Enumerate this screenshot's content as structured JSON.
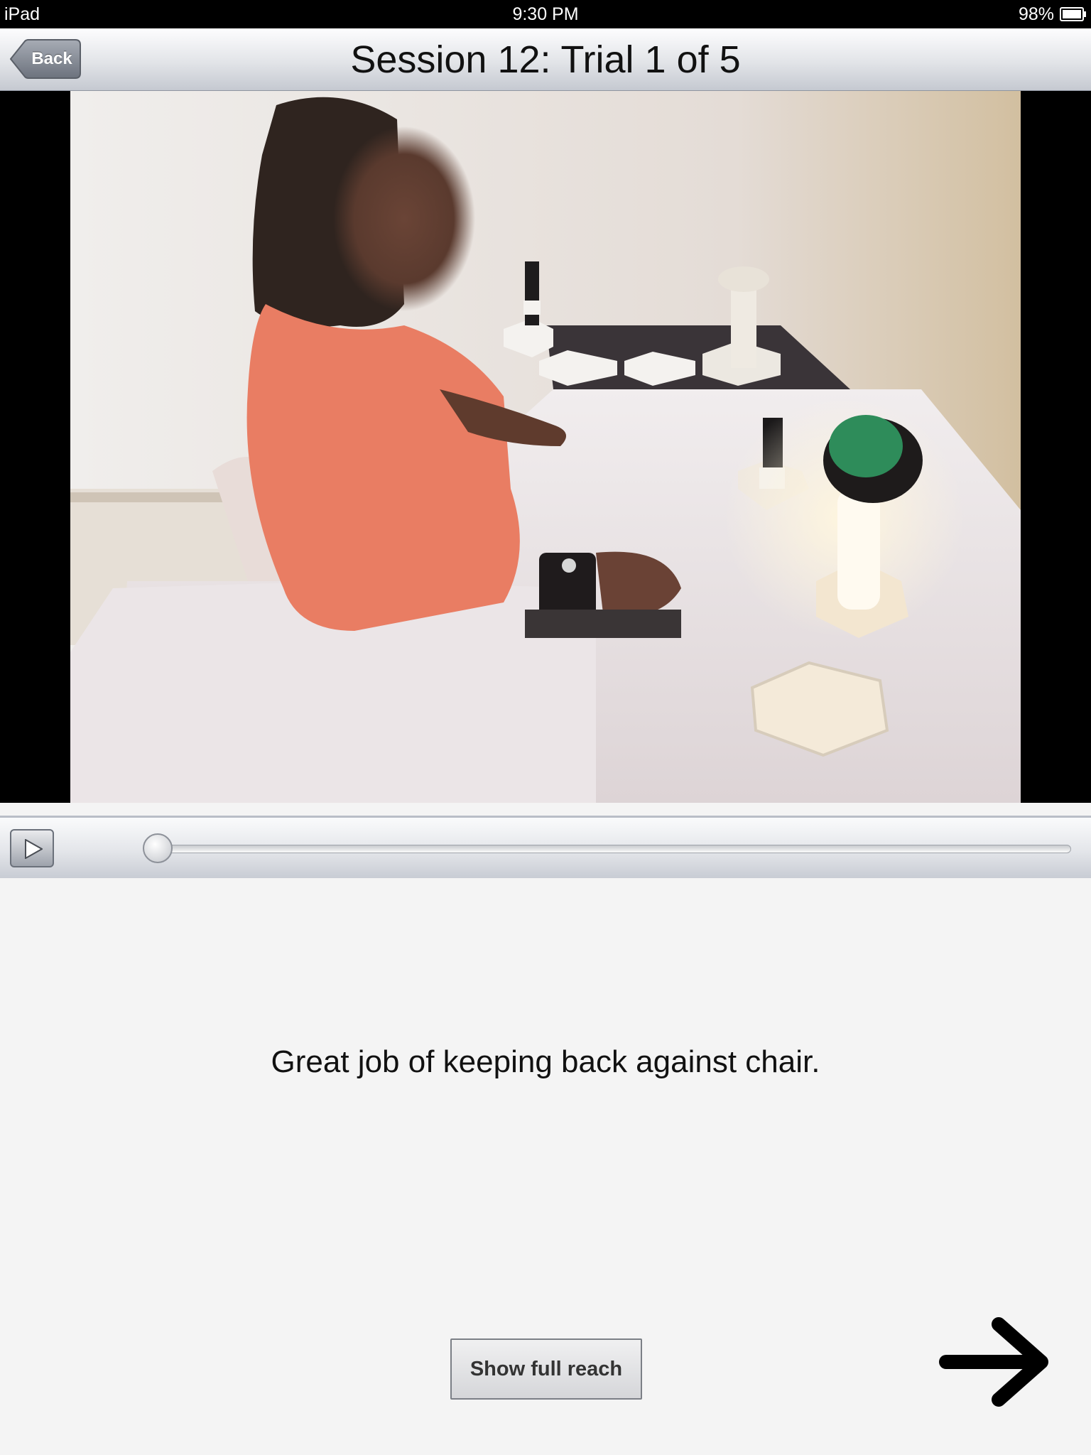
{
  "status_bar": {
    "device": "iPad",
    "time": "9:30 PM",
    "battery": "98%"
  },
  "nav": {
    "back_label": "Back",
    "title": "Session 12: Trial 1 of 5"
  },
  "player": {
    "progress": 0,
    "play_icon": "play-icon"
  },
  "feedback": {
    "message": "Great job of keeping back against chair."
  },
  "actions": {
    "show_full_reach_label": "Show full reach",
    "next_icon": "arrow-right-icon"
  }
}
